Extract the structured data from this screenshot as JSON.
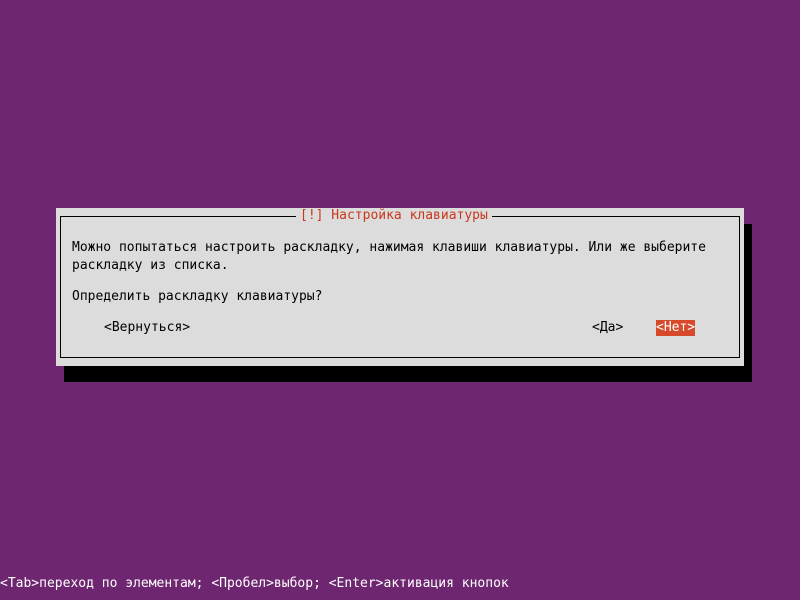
{
  "dialog": {
    "title": "[!] Настройка клавиатуры",
    "message_line_1": "Можно попытаться настроить раскладку, нажимая клавиши клавиатуры. Или же выберите",
    "message_line_2": "раскладку из списка.",
    "question": "Определить раскладку клавиатуры?",
    "buttons": {
      "back_label": "<Вернуться>",
      "yes_label": "<Да>",
      "no_label": "<Нет>",
      "selected": "no"
    }
  },
  "help_bar": {
    "text": "<Tab>переход по элементам; <Пробел>выбор; <Enter>активация кнопок"
  },
  "colors": {
    "background": "#6f2670",
    "dialog_bg": "#dcdcdc",
    "title_text": "#c8381c",
    "selected_button_bg": "#d64a2b"
  }
}
